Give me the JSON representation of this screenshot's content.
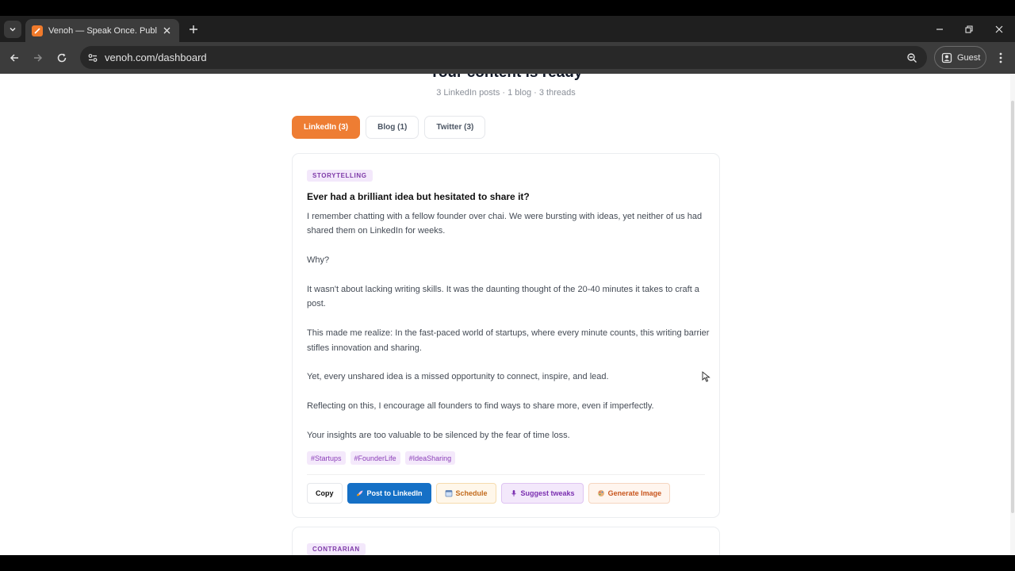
{
  "browser": {
    "tab_title": "Venoh — Speak Once. Publish E",
    "url": "venoh.com/dashboard",
    "profile_label": "Guest"
  },
  "page": {
    "title": "Your content is ready",
    "subtitle": "3 LinkedIn posts · 1 blog · 3 threads"
  },
  "filter_tabs": [
    {
      "label": "LinkedIn (3)",
      "active": true
    },
    {
      "label": "Blog (1)",
      "active": false
    },
    {
      "label": "Twitter (3)",
      "active": false
    }
  ],
  "post": {
    "style_badge": "STORYTELLING",
    "headline": "Ever had a brilliant idea but hesitated to share it?",
    "paragraphs": [
      "I remember chatting with a fellow founder over chai. We were bursting with ideas, yet neither of us had shared them on LinkedIn for weeks.",
      "Why?",
      "It wasn't about lacking writing skills. It was the daunting thought of the 20-40 minutes it takes to craft a post.",
      "This made me realize: In the fast-paced world of startups, where every minute counts, this writing barrier stifles innovation and sharing.",
      "Yet, every unshared idea is a missed opportunity to connect, inspire, and lead.",
      "Reflecting on this, I encourage all founders to find ways to share more, even if imperfectly.",
      "Your insights are too valuable to be silenced by the fear of time loss."
    ],
    "hashtags": [
      "#Startups",
      "#FounderLife",
      "#IdeaSharing"
    ],
    "actions": {
      "copy": "Copy",
      "post": "Post to LinkedIn",
      "schedule": "Schedule",
      "tweaks": "Suggest tweaks",
      "image": "Generate Image"
    }
  },
  "next_post": {
    "style_badge": "CONTRARIAN"
  },
  "colors": {
    "accent": "#ee7d33",
    "linkedin": "#1570c6",
    "badge_purple": "#7e3aa8"
  }
}
